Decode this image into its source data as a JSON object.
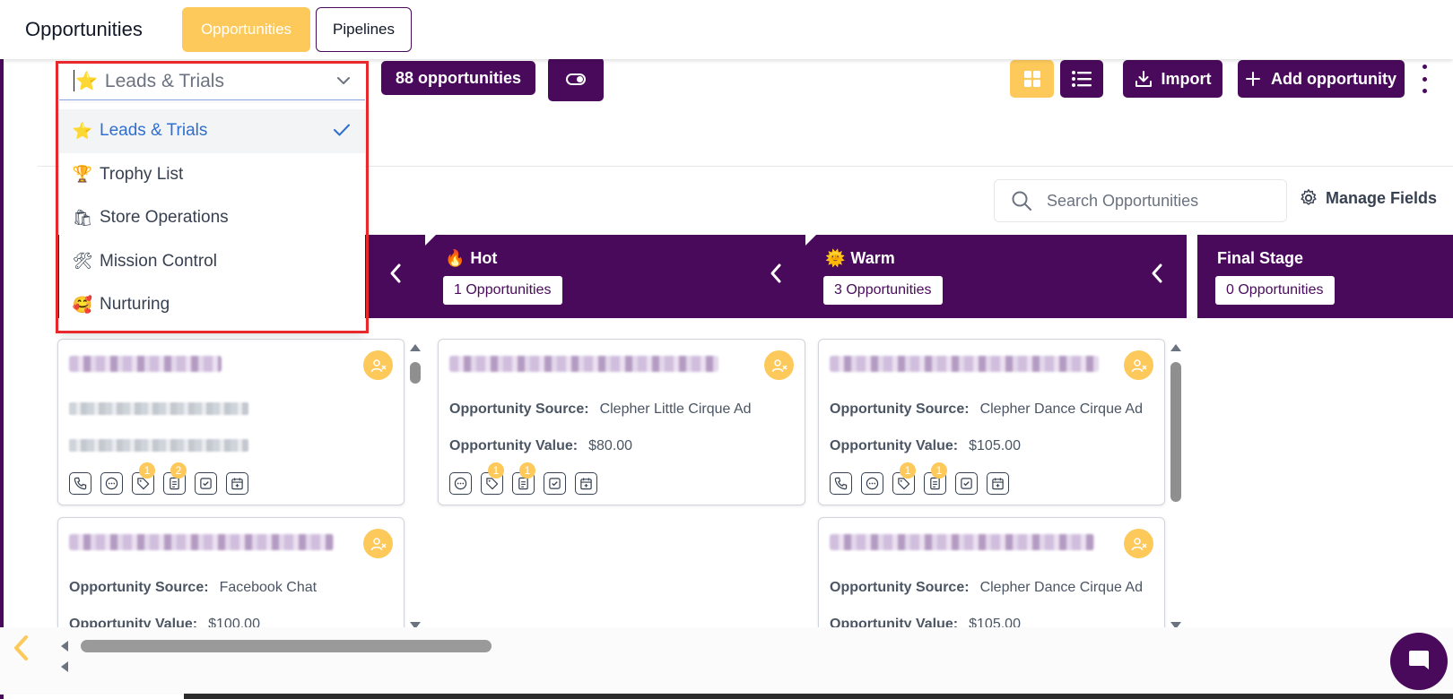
{
  "header": {
    "title": "Opportunities",
    "tabs": [
      {
        "label": "Opportunities",
        "active": true
      },
      {
        "label": "Pipelines",
        "active": false
      }
    ]
  },
  "toolbar": {
    "pipeline_select": {
      "value": "Leads & Trials",
      "icon": "star-icon"
    },
    "count_label": "88 opportunities",
    "import_label": "Import",
    "add_label": "Add opportunity"
  },
  "dropdown": {
    "items": [
      {
        "label": "Leads & Trials",
        "icon": "⭐",
        "selected": true
      },
      {
        "label": "Trophy List",
        "icon": "🏆",
        "selected": false
      },
      {
        "label": "Store Operations",
        "icon": "🛍",
        "selected": false
      },
      {
        "label": "Mission Control",
        "icon": "🛠",
        "selected": false
      },
      {
        "label": "Nurturing",
        "icon": "🥰",
        "selected": false
      }
    ]
  },
  "search": {
    "placeholder": "Search Opportunities"
  },
  "manage_fields_label": "Manage Fields",
  "stages": [
    {
      "name": "",
      "count_label": ""
    },
    {
      "name": "Hot",
      "icon": "🔥",
      "count_label": "1 Opportunities"
    },
    {
      "name": "Warm",
      "icon": "🌞",
      "count_label": "3 Opportunities"
    },
    {
      "name": "Final Stage",
      "count_label": "0 Opportunities"
    }
  ],
  "cards": {
    "col1": [
      {
        "source_label": "Opportunity Source:",
        "source": "Facebook Chat",
        "value_label": "Opportunity Value:",
        "value": "$100.00"
      }
    ],
    "hot": [
      {
        "source_label": "Opportunity Source:",
        "source": "Clepher Little Cirque Ad",
        "value_label": "Opportunity Value:",
        "value": "$80.00"
      }
    ],
    "warm": [
      {
        "source_label": "Opportunity Source:",
        "source": "Clepher Dance Cirque Ad",
        "value_label": "Opportunity Value:",
        "value": "$105.00"
      },
      {
        "source_label": "Opportunity Source:",
        "source": "Clepher Dance Cirque Ad",
        "value_label": "Opportunity Value:",
        "value": "$105.00"
      }
    ]
  },
  "badges": {
    "col1_tag": "1",
    "col1_note": "2",
    "hot_tag": "1",
    "hot_note": "1",
    "warm_tag": "1",
    "warm_note": "1"
  },
  "colors": {
    "brand": "#4a0a5c",
    "accent": "#fdc95a",
    "highlight": "#e8282b",
    "selected_text": "#2f6fd1"
  }
}
